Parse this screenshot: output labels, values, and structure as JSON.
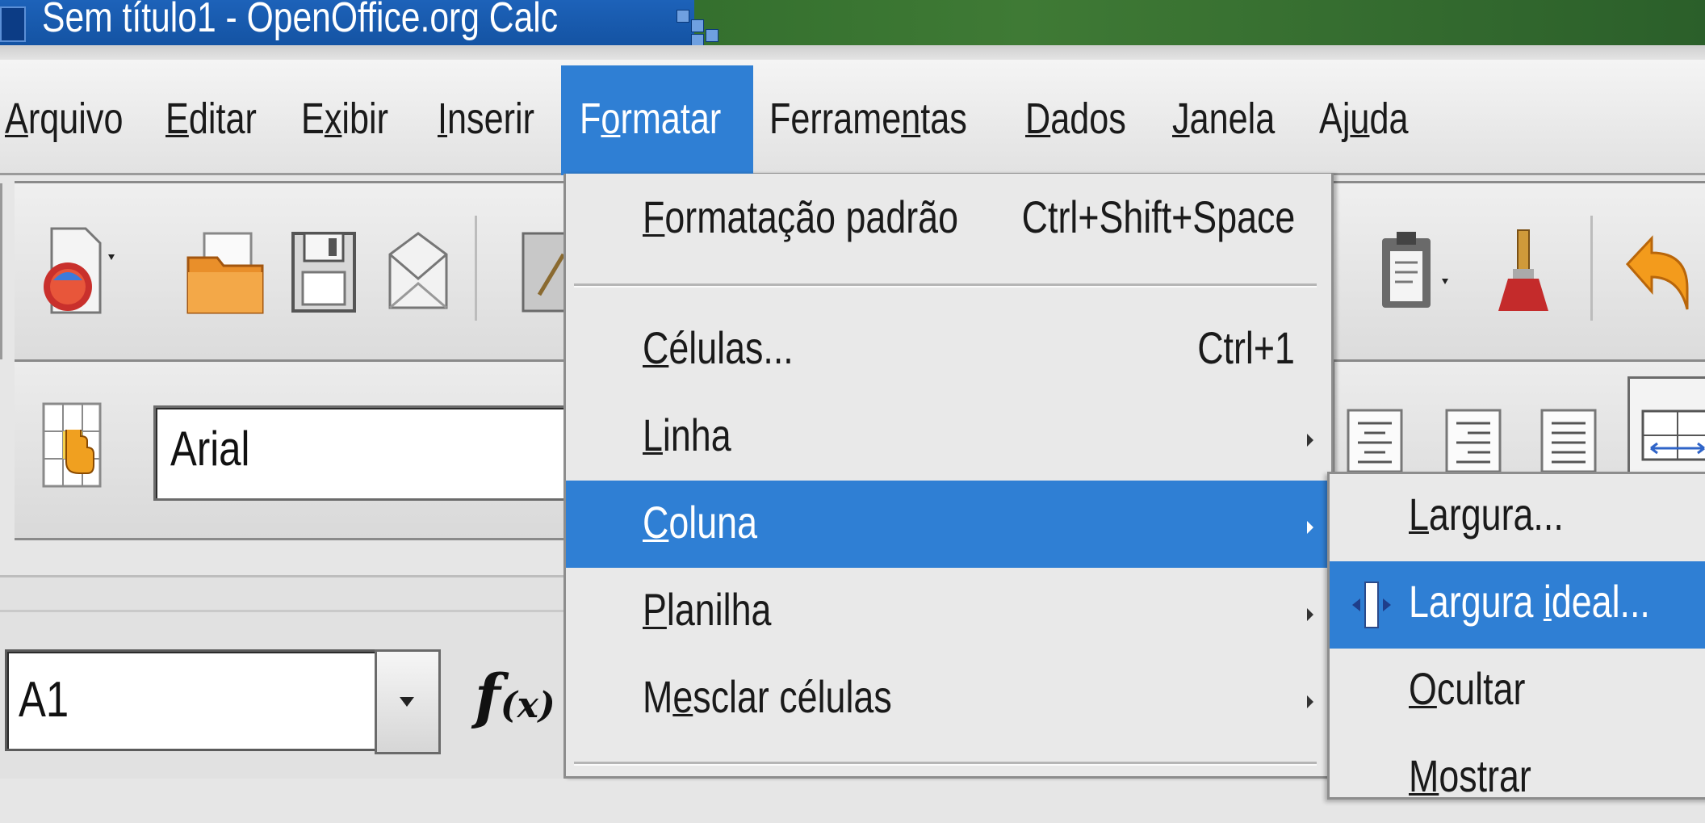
{
  "window": {
    "title": "Sem título1 - OpenOffice.org Calc"
  },
  "menubar": {
    "items": [
      {
        "pre": "",
        "key": "A",
        "post": "rquivo"
      },
      {
        "pre": "",
        "key": "E",
        "post": "ditar"
      },
      {
        "pre": "E",
        "key": "x",
        "post": "ibir"
      },
      {
        "pre": "",
        "key": "I",
        "post": "nserir"
      },
      {
        "pre": "F",
        "key": "o",
        "post": "rmatar"
      },
      {
        "pre": "Ferrame",
        "key": "n",
        "post": "tas"
      },
      {
        "pre": "",
        "key": "D",
        "post": "ados"
      },
      {
        "pre": "",
        "key": "J",
        "post": "anela"
      },
      {
        "pre": "Aj",
        "key": "u",
        "post": "da"
      }
    ],
    "active": "Formatar"
  },
  "toolbar": {
    "font_name": "Arial",
    "name_box": "A1",
    "function_icon": "f(x)"
  },
  "format_menu": {
    "items": [
      {
        "pre": "",
        "key": "F",
        "post": "ormatação padrão",
        "shortcut": "Ctrl+Shift+Space",
        "submenu": false,
        "highlighted": false
      },
      {
        "pre": "",
        "key": "C",
        "post": "élulas...",
        "shortcut": "Ctrl+1",
        "submenu": false,
        "highlighted": false
      },
      {
        "pre": "",
        "key": "L",
        "post": "inha",
        "shortcut": "",
        "submenu": true,
        "highlighted": false
      },
      {
        "pre": "",
        "key": "C",
        "post": "oluna",
        "shortcut": "",
        "submenu": true,
        "highlighted": true
      },
      {
        "pre": "",
        "key": "P",
        "post": "lanilha",
        "shortcut": "",
        "submenu": true,
        "highlighted": false
      },
      {
        "pre": "M",
        "key": "e",
        "post": "sclar células",
        "shortcut": "",
        "submenu": true,
        "highlighted": false
      }
    ]
  },
  "column_submenu": {
    "items": [
      {
        "pre": "",
        "key": "L",
        "post": "argura...",
        "highlighted": false
      },
      {
        "pre": "Largura ",
        "key": "i",
        "post": "deal...",
        "highlighted": true
      },
      {
        "pre": "",
        "key": "O",
        "post": "cultar",
        "highlighted": false
      },
      {
        "pre": "",
        "key": "M",
        "post": "ostrar",
        "highlighted": false
      }
    ]
  },
  "colors": {
    "highlight": "#2f7fd4",
    "menu_bg": "#e9e9e9",
    "titlebar": "#1d62b9"
  },
  "icons": [
    "new-document-icon",
    "open-folder-icon",
    "save-floppy-icon",
    "email-envelope-icon",
    "edit-pencil-icon",
    "paste-clipboard-icon",
    "format-paintbrush-icon",
    "undo-arrow-icon",
    "styles-icon",
    "align-center-icon",
    "align-right-icon",
    "justify-icon",
    "merge-cells-icon",
    "optimal-width-icon"
  ]
}
